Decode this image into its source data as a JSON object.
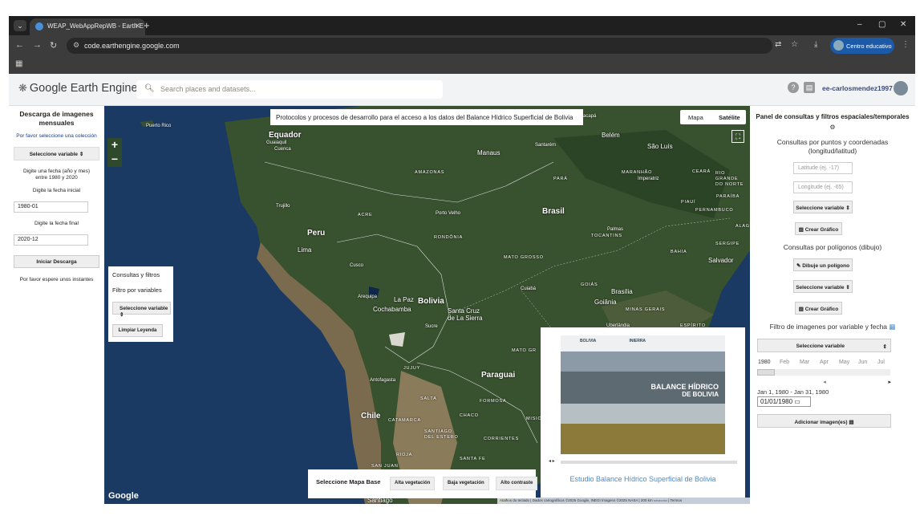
{
  "browser": {
    "tab_title": "WEAP_WebAppRepWB - Earth E",
    "url": "code.earthengine.google.com",
    "profile_label": "Centro educativo",
    "new_tab": "+",
    "win_min": "–",
    "win_max": "▢",
    "win_close": "✕"
  },
  "header": {
    "logo_text": "Google Earth Engine",
    "search_placeholder": "Search places and datasets...",
    "username": "ee-carlosmendez1997"
  },
  "left_panel": {
    "title": "Descarga de imagenes mensuales",
    "prompt_collection": "Por favor seleccione una colección",
    "select_variable": "Seleccione variable",
    "date_prompt": "Digite una fecha (año y mes) entre 1980 y 2020",
    "start_label": "Digite la fecha inicial",
    "start_value": "1980-01",
    "end_label": "Digite la fecha final",
    "end_value": "2020-12",
    "download_button": "Iniciar Descarga",
    "wait_text": "Por favor espere unos instantes"
  },
  "map": {
    "title": "Protocolos y procesos de desarrollo para el acceso a los datos del Balance Hídrico Superficial de Bolivia",
    "map_type_map": "Mapa",
    "map_type_satellite": "Satélite",
    "zoom_in": "+",
    "zoom_out": "−",
    "fullscreen": "⛶",
    "google_logo": "Google",
    "attribution": "Atalhos do teclado  |  Dados cartográficos ©2025 Google, INEGI Imagens ©2025 NASA  |  200 km ▭▭▭▭  |  Termos",
    "labels": {
      "puerto_rico": "Puerto Rico",
      "equador": "Equador",
      "guaiaquil": "Guaiaquil",
      "cuenca": "Cuenca",
      "manaus": "Manaus",
      "santarem": "Santarém",
      "belem": "Belém",
      "sao_luis": "São Luís",
      "amazonas": "AMAZONAS",
      "para": "PARÁ",
      "maranhao": "MARANHÃO",
      "ceara": "CEARÁ",
      "rio_grande": "RIO GRANDE DO NORTE",
      "imperatriz": "Imperatriz",
      "paraiba": "PARAÍBA",
      "piaui": "PIAUÍ",
      "pernambuco": "PERNAMBUCO",
      "brasil": "Brasil",
      "trujillo": "Trujillo",
      "acre": "ACRE",
      "porto_velho": "Porto Velho",
      "peru": "Peru",
      "rondonia": "RONDÔNIA",
      "palmas": "Palmas",
      "tocantins": "TOCANTINS",
      "sergipe": "SERGIPE",
      "alag": "ALAG",
      "lima": "Lima",
      "mato_grosso": "MATO GROSSO",
      "bahia": "BAHIA",
      "salvador": "Salvador",
      "cusco": "Cusco",
      "cuiaba": "Cuiabá",
      "goias": "GOIÁS",
      "brasilia": "Brasília",
      "arequipa": "Arequipa",
      "la_paz": "La Paz",
      "bolivia": "Bolivia",
      "cochabamba": "Cochabamba",
      "santa_cruz": "Santa Cruz de La Sierra",
      "goiania": "Goiânia",
      "minas_gerais": "MINAS GERAIS",
      "sucre": "Sucre",
      "uberlandia": "Uberlândia",
      "espirito": "ESPÍRITO",
      "mato_grosso_sul": "MATO GR",
      "jujuy": "JUJUY",
      "paraguai": "Paraguai",
      "antofagasta": "Antofagasta",
      "salta": "SALTA",
      "formosa": "FORMOSA",
      "chile": "Chile",
      "catamarca": "CATAMARCA",
      "chaco": "CHACO",
      "santiago_estero": "SANTIAGO DEL ESTERO",
      "corrientes": "CORRIENTES",
      "misiones": "MISIO",
      "rioja": "RIOJA",
      "santa_fe": "SANTA FE",
      "san_juan": "SAN JUAN",
      "santiago": "Santiago",
      "macapa": "Macapá"
    },
    "consultas": {
      "title": "Consultas y filtros",
      "subtitle": "Filtro por variables",
      "select_variable": "Seleccione variable",
      "clear_button": "Limpiar Leyenda"
    },
    "basemap": {
      "label": "Seleccione Mapa Base",
      "btn_veg_high": "Alta vegetación",
      "btn_veg_low": "Baja vegetación",
      "btn_contrast": "Alto contraste"
    },
    "study": {
      "header_left": "BOLIVIA",
      "header_right": "INIERRA",
      "cover_title": "BALANCE HÍDRICO",
      "cover_subtitle": "DE BOLIVIA",
      "nav_arrows": "◂ ▸",
      "link_text": "Estudio Balance Hídrico Superficial de Bolivia"
    }
  },
  "right_panel": {
    "title": "Panel de consultas y filtros espaciales/temporales",
    "points_title": "Consultas por puntos y coordenadas (longitud/latitud)",
    "lat_placeholder": "Latitude (ej. -17)",
    "lon_placeholder": "Longitude (ej. -65)",
    "select_variable_1": "Seleccione variable",
    "create_chart_1": "Crear Gráfico",
    "polygon_title": "Consultas por polígonos (dibujo)",
    "draw_polygon": "Dibuje un polígono",
    "select_variable_2": "Seleccione variable",
    "create_chart_2": "Crear Gráfico",
    "image_filter_title": "Filtro de imagenes por variable y fecha",
    "select_variable_3": "Seleccione variable",
    "months": [
      "1980",
      "Feb",
      "Mar",
      "Apr",
      "May",
      "Jun",
      "Jul"
    ],
    "date_range": "Jan 1, 1980 - Jan 31, 1980",
    "date_value": "01/01/1980",
    "add_images": "Adicionar imagen(es)"
  }
}
